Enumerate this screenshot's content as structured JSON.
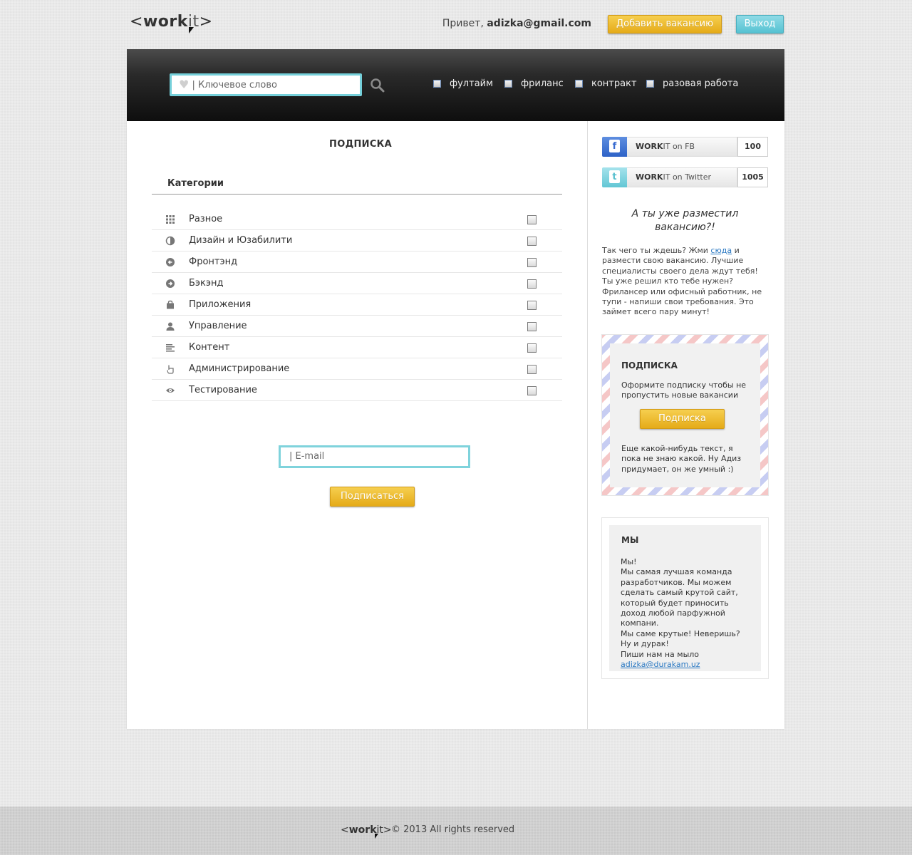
{
  "header": {
    "logo_left": "<",
    "logo_bold": "work",
    "logo_light": "it",
    "logo_right": ">",
    "greeting_prefix": "Привет, ",
    "user_email": "adizka@gmail.com",
    "add_vacancy_label": "Добавить вакансию",
    "logout_label": "Выход"
  },
  "search": {
    "placeholder": "| Ключевое слово",
    "job_types": [
      "фултайм",
      "фриланс",
      "контракт",
      "разовая работа"
    ]
  },
  "main": {
    "title": "ПОДПИСКА",
    "categories_heading": "Категории",
    "categories": [
      {
        "label": "Разное",
        "icon": "grid-icon"
      },
      {
        "label": "Дизайн и Юзабилити",
        "icon": "contrast-icon"
      },
      {
        "label": "Фронтэнд",
        "icon": "arrow-left-circle-icon"
      },
      {
        "label": "Бэкэнд",
        "icon": "arrow-right-circle-icon"
      },
      {
        "label": "Приложения",
        "icon": "bag-icon"
      },
      {
        "label": "Управление",
        "icon": "person-icon"
      },
      {
        "label": "Контент",
        "icon": "text-lines-icon"
      },
      {
        "label": "Администрирование",
        "icon": "hand-pointer-icon"
      },
      {
        "label": "Тестирование",
        "icon": "eye-icon"
      }
    ],
    "email_placeholder": "| E-mail",
    "subscribe_label": "Подписаться"
  },
  "sidebar": {
    "social": [
      {
        "icon": "facebook-icon",
        "glyph": "f",
        "brand": "WORK",
        "brand_light": "IT",
        "suffix": " on FB",
        "count": "100"
      },
      {
        "icon": "twitter-icon",
        "glyph": "t",
        "brand": "WORK",
        "brand_light": "IT",
        "suffix": " on Twitter",
        "count": "1005"
      }
    ],
    "promo_title": "А ты уже разместил вакансию?!",
    "promo_text_before": "Так чего ты ждешь? Жми ",
    "promo_link": "сюда",
    "promo_text_after": " и размести свою вакансию. Лучшие специалисты своего дела ждут тебя! Ты уже решил кто тебе нужен? Фрилансер или офисный работник, не тупи - напиши свои требования. Это займет всего пару минут!",
    "subscribe_box": {
      "title": "ПОДПИСКА",
      "text1": "Оформите подписку чтобы не пропустить новые вакансии",
      "button": "Подписка",
      "text2": "Еще какой-нибудь текст, я пока не знаю какой.  Ну Адиз придумает, он же умный :)"
    },
    "about": {
      "title": "МЫ",
      "lines": [
        "Мы!",
        "Мы самая лучшая команда разработчиков. Мы можем сделать самый крутой сайт, который будет приносить доход любой парфужной компани.",
        "Мы саме крутые! Неверишь?",
        "Ну и дурак!",
        "Пиши нам на мыло"
      ],
      "email": "adizka@durakam.uz"
    }
  },
  "footer": {
    "logo_left": "<",
    "logo_bold": "work",
    "logo_light": "it",
    "logo_right": ">",
    "copyright": "© 2013 All rights reserved"
  },
  "colors": {
    "accent_yellow": "#e5ab19",
    "accent_cyan": "#75d0da",
    "link_blue": "#2a78c2"
  }
}
